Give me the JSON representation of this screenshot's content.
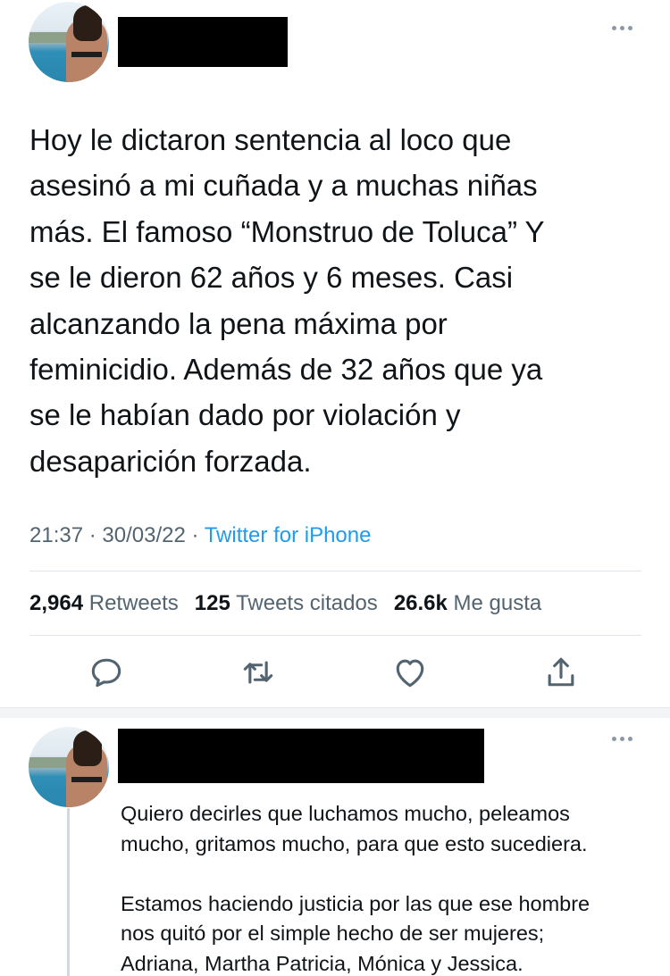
{
  "tweet": {
    "text": "Hoy le dictaron sentencia al loco que\nasesinó a mi cuñada y a muchas niñas\nmás. El famoso “Monstruo de Toluca” Y\nse le dieron 62 años y 6 meses. Casi\nalcanzando la pena máxima por\nfeminicidio. Además de 32 años que ya\nse le habían dado por violación y\ndesaparición forzada.",
    "time": "21:37",
    "sep1": " · ",
    "date": "30/03/22",
    "sep2": " · ",
    "source": "Twitter for iPhone"
  },
  "stats": {
    "retweets_count": "2,964",
    "retweets_label": "Retweets",
    "quotes_count": "125",
    "quotes_label": "Tweets citados",
    "likes_count": "26.6k",
    "likes_label": "Me gusta"
  },
  "actions": {
    "reply": "comment-icon",
    "retweet": "retweet-icon",
    "like": "heart-icon",
    "share": "share-icon"
  },
  "reply_tweet": {
    "text": "Quiero decirles que luchamos mucho, peleamos\nmucho, gritamos mucho, para que esto sucediera.\n\nEstamos haciendo justicia por las que ese hombre\nnos quitó por el simple hecho de ser mujeres;\nAdriana, Martha Patricia, Mónica y Jessica."
  },
  "colors": {
    "text_primary": "#0f1419",
    "text_secondary": "#536471",
    "link": "#1d9bf0",
    "icon": "#536471",
    "divider": "#e1e6ea"
  }
}
